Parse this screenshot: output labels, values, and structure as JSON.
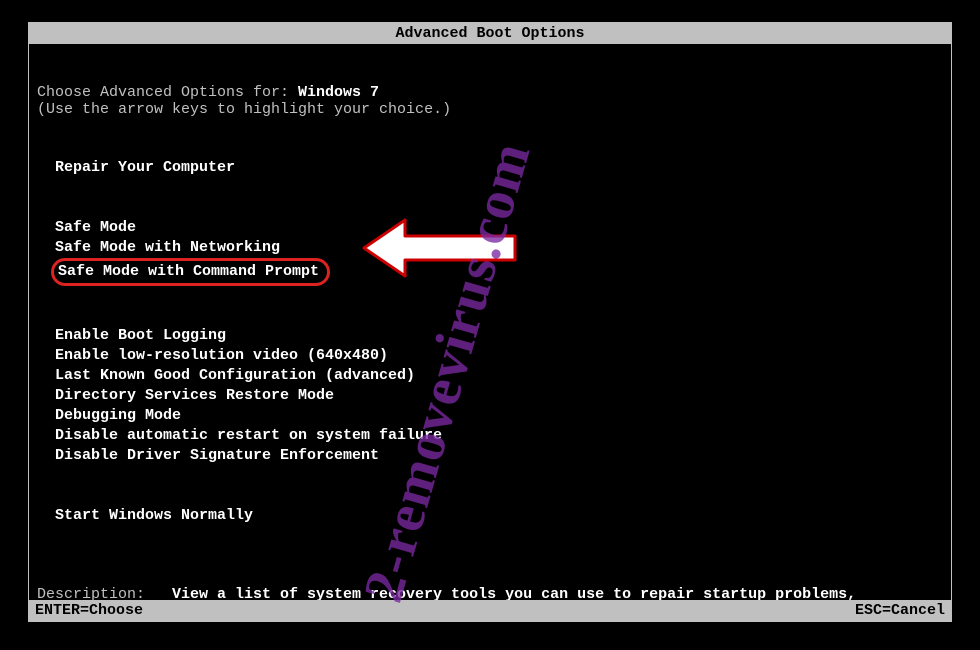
{
  "title": "Advanced Boot Options",
  "prompt": "Choose Advanced Options for: ",
  "os_name": "Windows 7",
  "hint": "(Use the arrow keys to highlight your choice.)",
  "groups": {
    "repair": [
      "Repair Your Computer"
    ],
    "safe": [
      "Safe Mode",
      "Safe Mode with Networking",
      "Safe Mode with Command Prompt"
    ],
    "advanced": [
      "Enable Boot Logging",
      "Enable low-resolution video (640x480)",
      "Last Known Good Configuration (advanced)",
      "Directory Services Restore Mode",
      "Debugging Mode",
      "Disable automatic restart on system failure",
      "Disable Driver Signature Enforcement"
    ],
    "normal": [
      "Start Windows Normally"
    ]
  },
  "description": {
    "label": "Description:",
    "text": "View a list of system recovery tools you can use to repair startup problems, run diagnostics, or restore your system."
  },
  "footer": {
    "enter": "ENTER=Choose",
    "esc": "ESC=Cancel"
  },
  "watermark": "2-removevirus.com"
}
